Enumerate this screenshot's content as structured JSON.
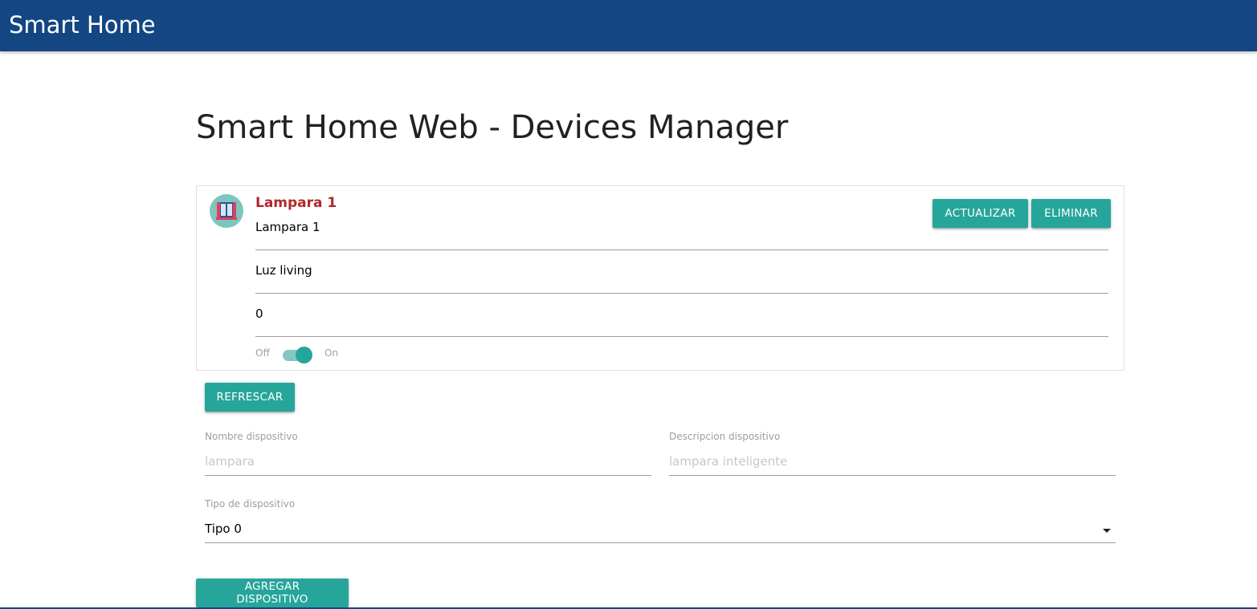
{
  "navbar": {
    "brand": "Smart Home"
  },
  "page": {
    "title": "Smart Home Web - Devices Manager"
  },
  "device": {
    "name": "Lampara 1",
    "name_value": "Lampara 1",
    "description_value": "Luz living",
    "state_value": "0",
    "switch": {
      "off_label": "Off",
      "on_label": "On",
      "is_on": true
    },
    "actions": {
      "update_label": "ACTUALIZAR",
      "delete_label": "ELIMINAR"
    },
    "avatar_icon": "window-icon"
  },
  "refresh_label": "REFRESCAR",
  "form": {
    "name_label": "Nombre dispositivo",
    "name_placeholder": "lampara",
    "description_label": "Descripcion dispositivo",
    "description_placeholder": "lampara inteligente",
    "type_label": "Tipo de dispositivo",
    "type_selected": "Tipo 0",
    "add_label": "AGREGAR DISPOSITIVO"
  },
  "colors": {
    "navbar": "#134683",
    "accent": "#26a69a",
    "device_title": "#b0282b"
  }
}
